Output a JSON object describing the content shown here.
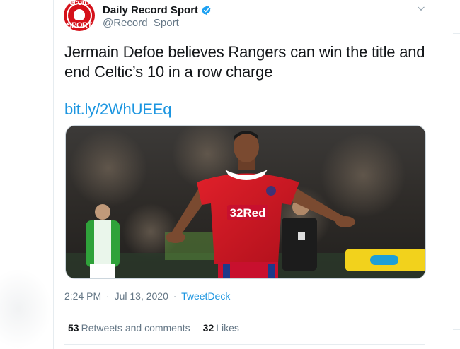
{
  "account": {
    "display_name": "Daily Record Sport",
    "handle": "@Record_Sport",
    "avatar_text_top": "ecord",
    "avatar_text_bottom": "SPORT",
    "verified": true
  },
  "tweet": {
    "text": "Jermain Defoe believes Rangers can win the title and end Celtic’s 10 in a row charge",
    "link": "bit.ly/2WhUEEq",
    "time": "2:24 PM",
    "date": "Jul 13, 2020",
    "source": "TweetDeck",
    "separator": "·"
  },
  "stats": {
    "retweets_count": "53",
    "retweets_label": "Retweets and comments",
    "likes_count": "32",
    "likes_label": "Likes"
  },
  "media": {
    "shirt_sponsor": "32Red"
  },
  "icons": {
    "verified": "verified-badge-icon",
    "caret": "chevron-down-icon"
  },
  "colors": {
    "link": "#1b95e0",
    "secondary_text": "#657786",
    "verified": "#1da1f2",
    "jersey": "#c8102e"
  }
}
